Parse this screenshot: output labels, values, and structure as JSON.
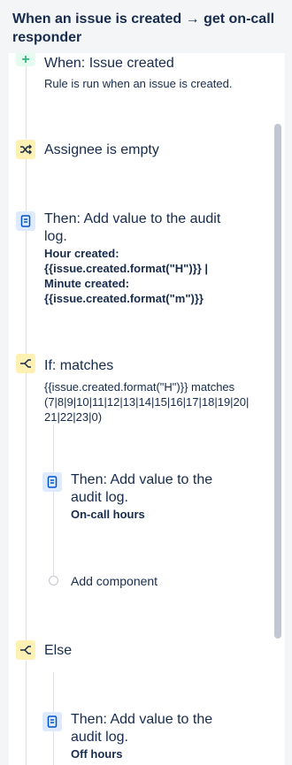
{
  "header": {
    "title": "When an issue is created → get on-call responder"
  },
  "trigger": {
    "title": "When: Issue created",
    "description": "Rule is run when an issue is created."
  },
  "condition_assignee": {
    "title": "Assignee is empty"
  },
  "action_audit_1": {
    "title_line1": "Then: Add value to the audit",
    "title_line2": "log.",
    "desc_line1": "Hour created:",
    "desc_line2": "{{issue.created.format(\"H\")}} |",
    "desc_line3": "Minute created:",
    "desc_line4": "{{issue.created.format(\"m\")}}"
  },
  "if_block": {
    "title": "If: matches",
    "desc_line1": "{{issue.created.format(\"H\")}} matches",
    "desc_line2": "(7|8|9|10|11|12|13|14|15|16|17|18|19|20|",
    "desc_line3": "21|22|23|0)"
  },
  "action_audit_2": {
    "title_line1": "Then: Add value to the",
    "title_line2": "audit log.",
    "desc": "On-call hours"
  },
  "add_component": {
    "label": "Add component"
  },
  "else_block": {
    "title": "Else"
  },
  "action_audit_3": {
    "title_line1": "Then: Add value to the",
    "title_line2": "audit log.",
    "desc": "Off hours"
  }
}
